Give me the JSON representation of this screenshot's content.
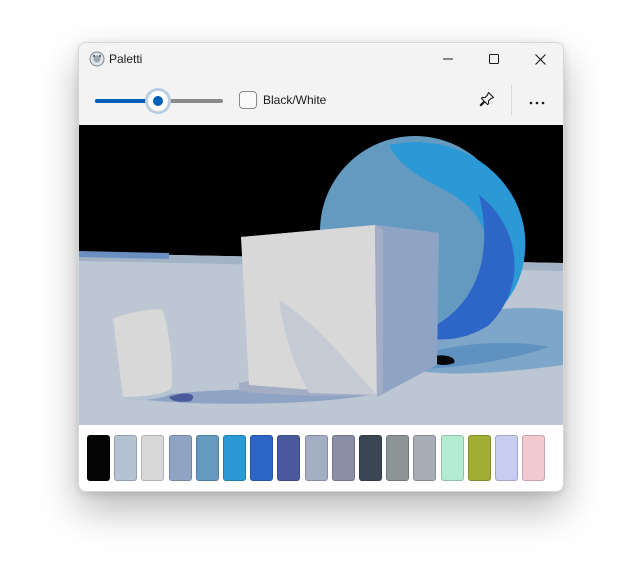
{
  "window": {
    "title": "Paletti",
    "app_icon": "palette-app-icon",
    "caption_buttons": [
      "minimize-icon",
      "maximize-icon",
      "close-icon"
    ]
  },
  "toolbar": {
    "slider": {
      "value_fraction": 0.49
    },
    "black_white": {
      "label": "Black/White",
      "checked": false
    },
    "pin_icon": "pin-icon",
    "more_icon": "more-icon"
  },
  "colors": {
    "accent": "#005fb8"
  },
  "palette": {
    "swatches": [
      "#050505",
      "#b4c2d2",
      "#d8d8d8",
      "#8fa3c4",
      "#6499c0",
      "#2a99d6",
      "#2d66c6",
      "#4a5a9c",
      "#a3adc4",
      "#8a8ea6",
      "#3b4654",
      "#8c9496",
      "#a8acb4",
      "#b3ebd0",
      "#a2ad34",
      "#c7ccf0",
      "#f2c9d0"
    ]
  }
}
